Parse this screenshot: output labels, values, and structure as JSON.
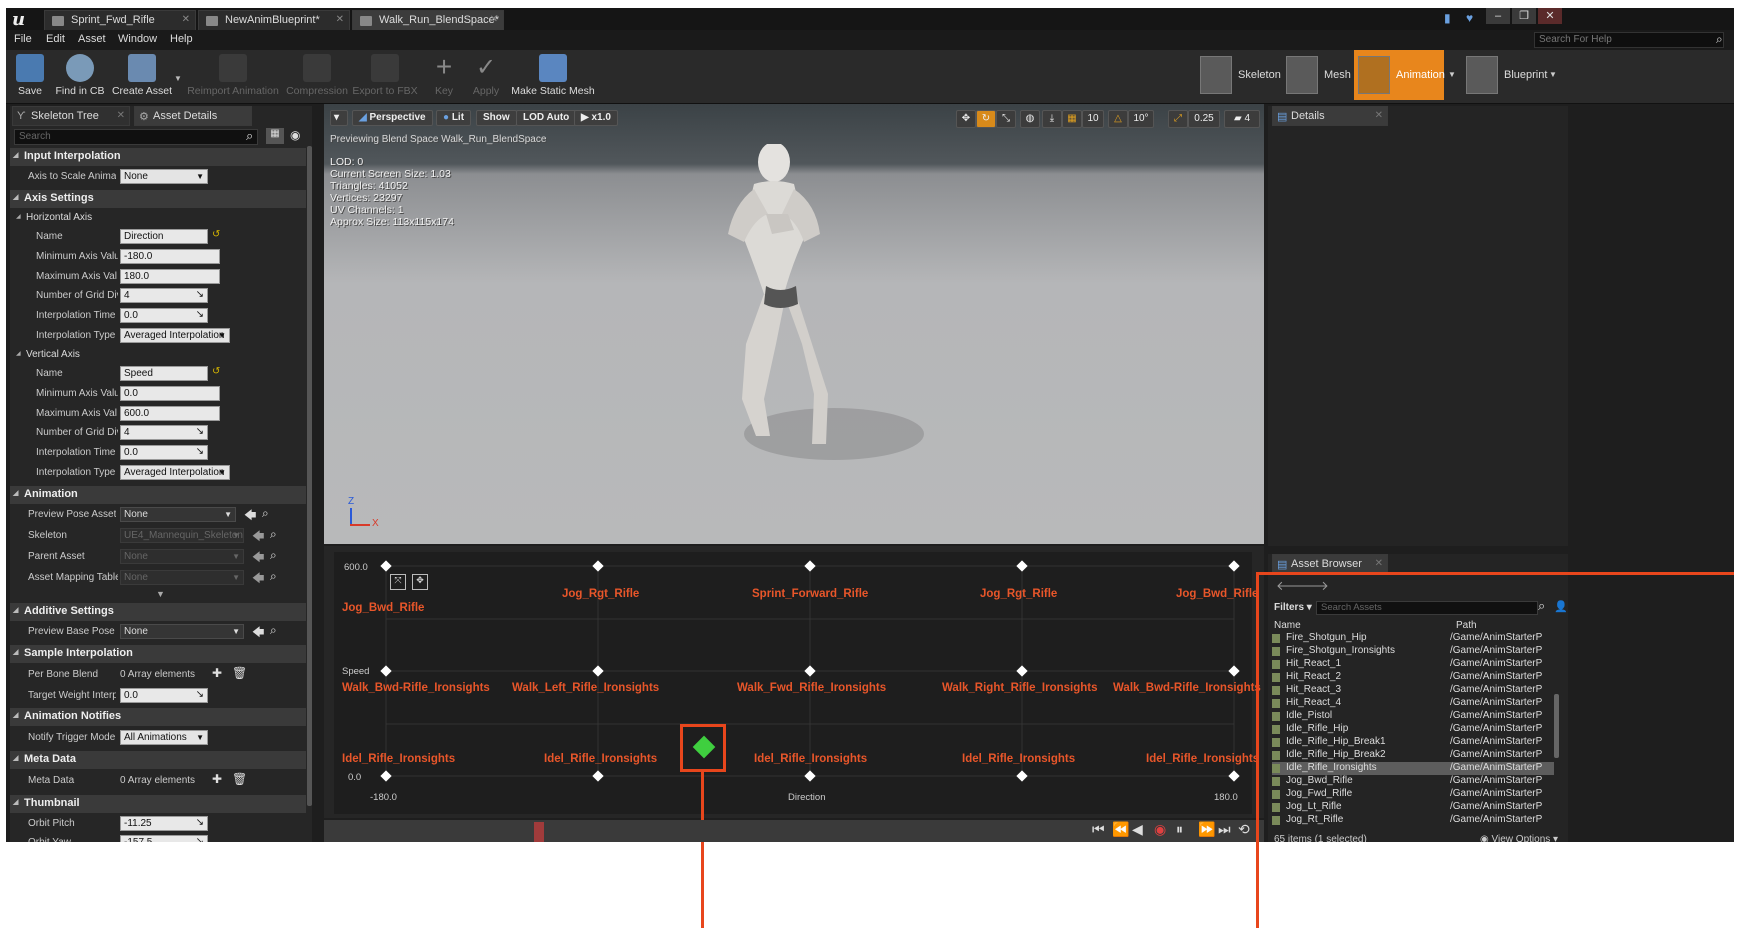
{
  "window": {
    "tabs": [
      {
        "label": "Sprint_Fwd_Rifle"
      },
      {
        "label": "NewAnimBlueprint*"
      },
      {
        "label": "Walk_Run_BlendSpace*"
      }
    ],
    "buttons": {
      "minimize": "–",
      "maximize": "❐",
      "close": "✕"
    }
  },
  "menubar": {
    "items": [
      "File",
      "Edit",
      "Asset",
      "Window",
      "Help"
    ],
    "help_search_placeholder": "Search For Help"
  },
  "toolbar": {
    "buttons": [
      {
        "label": "Save",
        "enabled": true,
        "icon": "save-icon"
      },
      {
        "label": "Find in CB",
        "enabled": true,
        "icon": "magnifier-icon"
      },
      {
        "label": "Create Asset",
        "enabled": true,
        "icon": "create-asset-icon"
      },
      {
        "label": "Reimport Animation",
        "enabled": false,
        "icon": "reimport-icon"
      },
      {
        "label": "Compression",
        "enabled": false,
        "icon": "compression-icon"
      },
      {
        "label": "Export to FBX",
        "enabled": false,
        "icon": "export-icon"
      },
      {
        "label": "Key",
        "enabled": false,
        "icon": "plus-icon"
      },
      {
        "label": "Apply",
        "enabled": false,
        "icon": "check-icon"
      },
      {
        "label": "Make Static Mesh",
        "enabled": true,
        "icon": "static-mesh-icon"
      }
    ],
    "modes": [
      {
        "label": "Skeleton"
      },
      {
        "label": "Mesh"
      },
      {
        "label": "Animation",
        "active": true
      },
      {
        "label": "Blueprint"
      }
    ]
  },
  "left_panel": {
    "tabs": [
      "Skeleton Tree",
      "Asset Details"
    ],
    "search_placeholder": "Search",
    "sections": {
      "input_interpolation": {
        "title": "Input Interpolation",
        "axis_to_scale_label": "Axis to Scale Animat",
        "axis_to_scale_value": "None"
      },
      "axis_settings": {
        "title": "Axis Settings",
        "horizontal": {
          "title": "Horizontal Axis",
          "name_label": "Name",
          "name_value": "Direction",
          "min_label": "Minimum Axis Valu",
          "min_value": "-180.0",
          "max_label": "Maximum Axis Val",
          "max_value": "180.0",
          "grid_label": "Number of Grid Div",
          "grid_value": "4",
          "interp_time_label": "Interpolation Time",
          "interp_time_value": "0.0",
          "interp_type_label": "Interpolation Type",
          "interp_type_value": "Averaged Interpolation"
        },
        "vertical": {
          "title": "Vertical Axis",
          "name_label": "Name",
          "name_value": "Speed",
          "min_label": "Minimum Axis Valu",
          "min_value": "0.0",
          "max_label": "Maximum Axis Val",
          "max_value": "600.0",
          "grid_label": "Number of Grid Div",
          "grid_value": "4",
          "interp_time_label": "Interpolation Time",
          "interp_time_value": "0.0",
          "interp_type_label": "Interpolation Type",
          "interp_type_value": "Averaged Interpolation"
        }
      },
      "animation": {
        "title": "Animation",
        "preview_pose_label": "Preview Pose Asset",
        "preview_pose_value": "None",
        "skeleton_label": "Skeleton",
        "skeleton_value": "UE4_Mannequin_Skeleton",
        "parent_label": "Parent Asset",
        "parent_value": "None",
        "mapping_label": "Asset Mapping Table",
        "mapping_value": "None"
      },
      "additive": {
        "title": "Additive Settings",
        "base_pose_label": "Preview Base Pose",
        "base_pose_value": "None"
      },
      "sample_interp": {
        "title": "Sample Interpolation",
        "per_bone_label": "Per Bone Blend",
        "per_bone_value": "0 Array elements",
        "target_weight_label": "Target Weight Interpo",
        "target_weight_value": "0.0"
      },
      "notifies": {
        "title": "Animation Notifies",
        "trigger_label": "Notify Trigger Mode",
        "trigger_value": "All Animations"
      },
      "meta": {
        "title": "Meta Data",
        "meta_label": "Meta Data",
        "meta_value": "0 Array elements"
      },
      "thumbnail": {
        "title": "Thumbnail",
        "pitch_label": "Orbit Pitch",
        "pitch_value": "-11.25",
        "yaw_label": "Orbit Yaw",
        "yaw_value": "-157.5"
      }
    }
  },
  "viewport": {
    "buttons": {
      "perspective": "Perspective",
      "lit": "Lit",
      "show": "Show",
      "lod": "LOD Auto",
      "speed": "x1.0"
    },
    "snap_values": {
      "grid": "10",
      "angle": "10°",
      "scale": "0.25",
      "camera": "4"
    },
    "preview_text": "Previewing Blend Space Walk_Run_BlendSpace",
    "stats": [
      "LOD: 0",
      "Current Screen Size: 1.03",
      "Triangles: 41052",
      "Vertices: 23297",
      "UV Channels: 1",
      "Approx Size: 113x115x174"
    ],
    "axis_z": "Z",
    "axis_x": "X"
  },
  "blendspace": {
    "y_axis": {
      "label": "Speed",
      "min": "0.0",
      "max": "600.0"
    },
    "x_axis": {
      "label": "Direction",
      "min": "-180.0",
      "max": "180.0"
    },
    "columns": 5,
    "rows": 3,
    "samples_top": [
      "Jog_Bwd_Rifle",
      "Jog_Rgt_Rifle",
      "Sprint_Forward_Rifle",
      "Jog_Rgt_Rifle",
      "Jog_Bwd_Rifle"
    ],
    "samples_mid": [
      "Walk_Bwd-Rifle_Ironsights",
      "Walk_Left_Rifle_Ironsights",
      "Walk_Fwd_Rifle_Ironsights",
      "Walk_Right_Rifle_Ironsights",
      "Walk_Bwd-Rifle_Ironsights"
    ],
    "samples_bottom": [
      "Idel_Rifle_Ironsights",
      "Idel_Rifle_Ironsights",
      "Idel_Rifle_Ironsights",
      "Idel_Rifle_Ironsights",
      "Idel_Rifle_Ironsights"
    ],
    "preview_color": "#3fcf3f",
    "highlight_color": "#e8461c",
    "sample_color": "#e8562a"
  },
  "details_panel": {
    "title": "Details"
  },
  "asset_browser": {
    "title": "Asset Browser",
    "filters_label": "Filters",
    "search_placeholder": "Search Assets",
    "columns": {
      "name": "Name",
      "path": "Path"
    },
    "rows": [
      {
        "name": "Fire_Shotgun_Hip",
        "path": "/Game/AnimStarterP"
      },
      {
        "name": "Fire_Shotgun_Ironsights",
        "path": "/Game/AnimStarterP"
      },
      {
        "name": "Hit_React_1",
        "path": "/Game/AnimStarterP"
      },
      {
        "name": "Hit_React_2",
        "path": "/Game/AnimStarterP"
      },
      {
        "name": "Hit_React_3",
        "path": "/Game/AnimStarterP"
      },
      {
        "name": "Hit_React_4",
        "path": "/Game/AnimStarterP"
      },
      {
        "name": "Idle_Pistol",
        "path": "/Game/AnimStarterP"
      },
      {
        "name": "Idle_Rifle_Hip",
        "path": "/Game/AnimStarterP"
      },
      {
        "name": "Idle_Rifle_Hip_Break1",
        "path": "/Game/AnimStarterP"
      },
      {
        "name": "Idle_Rifle_Hip_Break2",
        "path": "/Game/AnimStarterP"
      },
      {
        "name": "Idle_Rifle_Ironsights",
        "path": "/Game/AnimStarterP",
        "selected": true
      },
      {
        "name": "Jog_Bwd_Rifle",
        "path": "/Game/AnimStarterP"
      },
      {
        "name": "Jog_Fwd_Rifle",
        "path": "/Game/AnimStarterP"
      },
      {
        "name": "Jog_Lt_Rifle",
        "path": "/Game/AnimStarterP"
      },
      {
        "name": "Jog_Rt_Rifle",
        "path": "/Game/AnimStarterP"
      }
    ],
    "status": "65 items (1 selected)",
    "view_options": "View Options"
  }
}
